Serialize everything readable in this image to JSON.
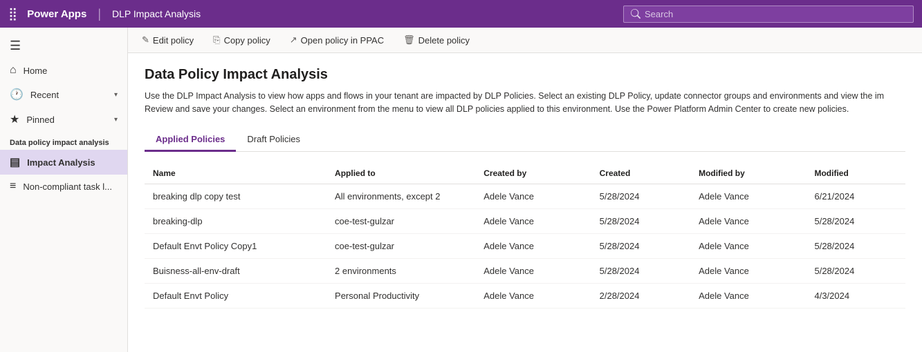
{
  "topnav": {
    "app_name": "Power Apps",
    "page_title": "DLP Impact Analysis",
    "search_placeholder": "Search"
  },
  "sidebar": {
    "hamburger_icon": "☰",
    "items": [
      {
        "id": "home",
        "label": "Home",
        "icon": "⌂",
        "has_chevron": false
      },
      {
        "id": "recent",
        "label": "Recent",
        "icon": "🕐",
        "has_chevron": true
      },
      {
        "id": "pinned",
        "label": "Pinned",
        "icon": "★",
        "has_chevron": true
      }
    ],
    "section_label": "Data policy impact analysis",
    "subitems": [
      {
        "id": "impact-analysis",
        "label": "Impact Analysis",
        "icon": "▤",
        "active": true
      },
      {
        "id": "non-compliant",
        "label": "Non-compliant task l...",
        "icon": "≡",
        "active": false
      }
    ]
  },
  "toolbar": {
    "buttons": [
      {
        "id": "edit-policy",
        "label": "Edit policy",
        "icon": "✎"
      },
      {
        "id": "copy-policy",
        "label": "Copy policy",
        "icon": "⎘"
      },
      {
        "id": "open-policy-ppac",
        "label": "Open policy in PPAC",
        "icon": "↗"
      },
      {
        "id": "delete-policy",
        "label": "Delete policy",
        "icon": "🗑"
      }
    ]
  },
  "main": {
    "title": "Data Policy Impact Analysis",
    "description_part1": "Use the DLP Impact Analysis to view how apps and flows in your tenant are impacted by DLP Policies. Select an existing DLP Policy, update connector groups and environments and view the im",
    "description_part2": "Review and save your changes. Select an environment from the menu to view all DLP policies applied to this environment. Use the Power Platform Admin Center to create new policies.",
    "tabs": [
      {
        "id": "applied",
        "label": "Applied Policies",
        "active": true
      },
      {
        "id": "draft",
        "label": "Draft Policies",
        "active": false
      }
    ],
    "table": {
      "columns": [
        {
          "id": "name",
          "label": "Name"
        },
        {
          "id": "applied_to",
          "label": "Applied to"
        },
        {
          "id": "created_by",
          "label": "Created by"
        },
        {
          "id": "created",
          "label": "Created"
        },
        {
          "id": "modified_by",
          "label": "Modified by"
        },
        {
          "id": "modified",
          "label": "Modified"
        }
      ],
      "rows": [
        {
          "name": "breaking dlp copy test",
          "name_is_link": true,
          "applied_to": "All environments, except 2",
          "applied_to_is_link": true,
          "created_by": "Adele Vance",
          "created": "5/28/2024",
          "modified_by": "Adele Vance",
          "modified": "6/21/2024"
        },
        {
          "name": "breaking-dlp",
          "name_is_link": true,
          "applied_to": "coe-test-gulzar",
          "applied_to_is_link": false,
          "created_by": "Adele Vance",
          "created": "5/28/2024",
          "modified_by": "Adele Vance",
          "modified": "5/28/2024"
        },
        {
          "name": "Default Envt Policy Copy1",
          "name_is_link": false,
          "applied_to": "coe-test-gulzar",
          "applied_to_is_link": false,
          "created_by": "Adele Vance",
          "created": "5/28/2024",
          "modified_by": "Adele Vance",
          "modified": "5/28/2024"
        },
        {
          "name": "Buisness-all-env-draft",
          "name_is_link": false,
          "applied_to": "2 environments",
          "applied_to_is_link": false,
          "created_by": "Adele Vance",
          "created": "5/28/2024",
          "modified_by": "Adele Vance",
          "modified": "5/28/2024"
        },
        {
          "name": "Default Envt Policy",
          "name_is_link": false,
          "applied_to": "Personal Productivity",
          "applied_to_is_link": true,
          "created_by": "Adele Vance",
          "created": "2/28/2024",
          "modified_by": "Adele Vance",
          "modified": "4/3/2024"
        }
      ]
    }
  }
}
